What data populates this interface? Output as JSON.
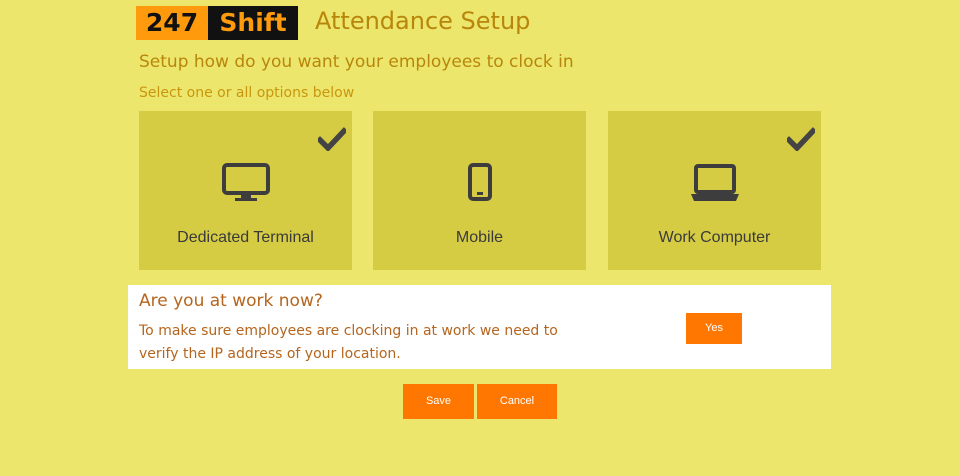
{
  "header": {
    "logo_number": "247",
    "logo_word": "Shift",
    "title": "Attendance Setup"
  },
  "intro": {
    "subtitle": "Setup how do you want your employees to clock in",
    "hint": "Select one or all options below"
  },
  "options": [
    {
      "label": "Dedicated Terminal",
      "icon": "monitor-icon",
      "selected": true
    },
    {
      "label": "Mobile",
      "icon": "mobile-phone-icon",
      "selected": false
    },
    {
      "label": "Work Computer",
      "icon": "laptop-icon",
      "selected": true
    }
  ],
  "confirm": {
    "title": "Are you at work now?",
    "body": "To make sure employees are clocking in at work we need to verify the IP address of your location.",
    "yes_label": "Yes"
  },
  "actions": {
    "save_label": "Save",
    "cancel_label": "Cancel"
  },
  "colors": {
    "background": "#ede66c",
    "tile": "#d6cc44",
    "accent": "#ff7700",
    "heading": "#b8860b"
  }
}
